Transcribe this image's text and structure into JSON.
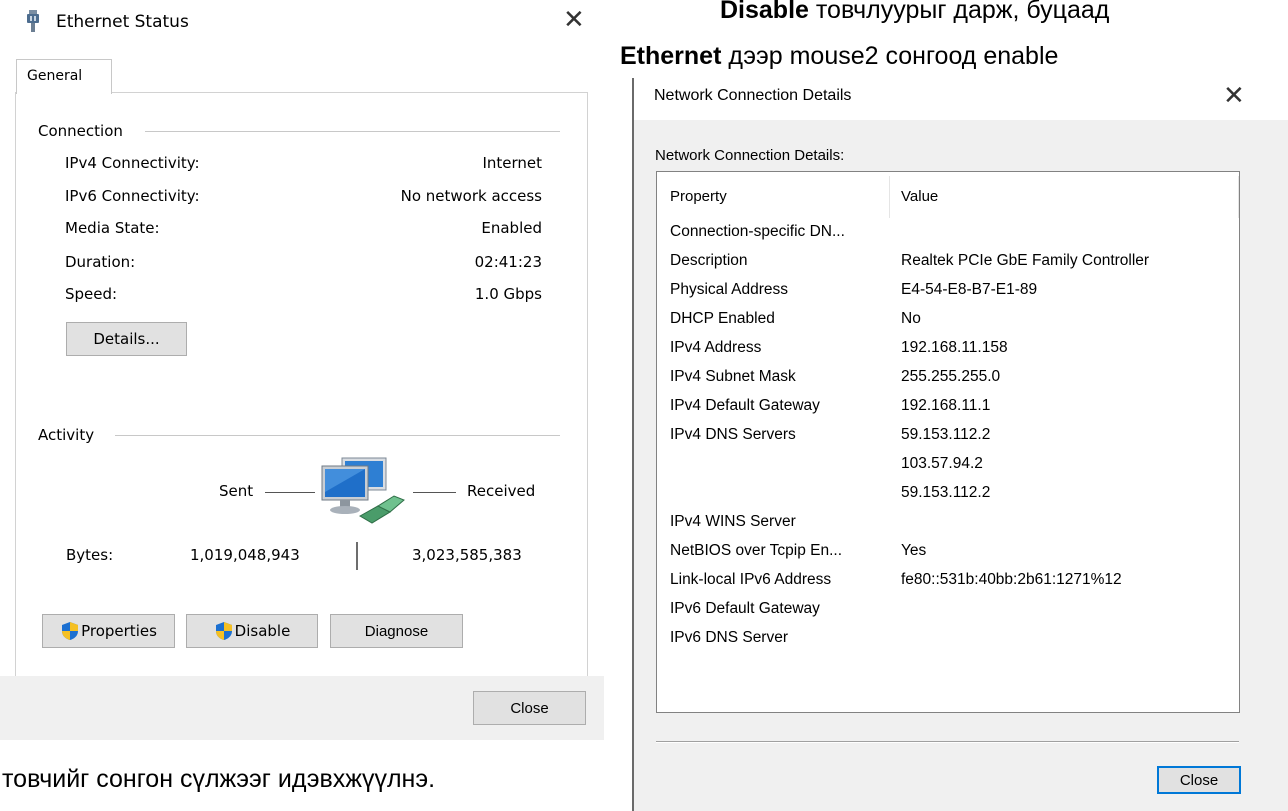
{
  "instruction": {
    "line1_bold": "Disable",
    "line1_rest": "товчлуурыг дарж, буцаад",
    "line2_bold": "Ethernet",
    "line2_rest": "дээр mouse2 сонгоод enable",
    "line3": "товчийг сонгон сүлжээг идэвхжүүлнэ."
  },
  "ethernet_status": {
    "title": "Ethernet Status",
    "close_glyph": "✕",
    "tab": "General",
    "connection_group": "Connection",
    "rows": [
      {
        "label": "IPv4 Connectivity:",
        "value": "Internet"
      },
      {
        "label": "IPv6 Connectivity:",
        "value": "No network access"
      },
      {
        "label": "Media State:",
        "value": "Enabled"
      },
      {
        "label": "Duration:",
        "value": "02:41:23"
      },
      {
        "label": "Speed:",
        "value": "1.0 Gbps"
      }
    ],
    "details_button": "Details...",
    "activity_group": "Activity",
    "sent_label": "Sent",
    "received_label": "Received",
    "bytes_label": "Bytes:",
    "bytes_sent": "1,019,048,943",
    "bytes_received": "3,023,585,383",
    "properties_button": "Properties",
    "disable_button": "Disable",
    "diagnose_button": "Diagnose",
    "close_button": "Close"
  },
  "network_details": {
    "title": "Network Connection Details",
    "close_glyph": "✕",
    "list_label": "Network Connection Details:",
    "header_property": "Property",
    "header_value": "Value",
    "rows": [
      {
        "property": "Connection-specific DN...",
        "value": ""
      },
      {
        "property": "Description",
        "value": "Realtek PCIe GbE Family Controller"
      },
      {
        "property": "Physical Address",
        "value": "E4-54-E8-B7-E1-89"
      },
      {
        "property": "DHCP Enabled",
        "value": "No"
      },
      {
        "property": "IPv4 Address",
        "value": "192.168.11.158"
      },
      {
        "property": "IPv4 Subnet Mask",
        "value": "255.255.255.0"
      },
      {
        "property": "IPv4 Default Gateway",
        "value": "192.168.11.1"
      },
      {
        "property": "IPv4 DNS Servers",
        "value": "59.153.112.2"
      },
      {
        "property": "",
        "value": "103.57.94.2"
      },
      {
        "property": "",
        "value": "59.153.112.2"
      },
      {
        "property": "IPv4 WINS Server",
        "value": ""
      },
      {
        "property": "NetBIOS over Tcpip En...",
        "value": "Yes"
      },
      {
        "property": "Link-local IPv6 Address",
        "value": "fe80::531b:40bb:2b61:1271%12"
      },
      {
        "property": "IPv6 Default Gateway",
        "value": ""
      },
      {
        "property": "IPv6 DNS Server",
        "value": ""
      }
    ],
    "close_button": "Close",
    "accent_color": "#0078d7"
  }
}
